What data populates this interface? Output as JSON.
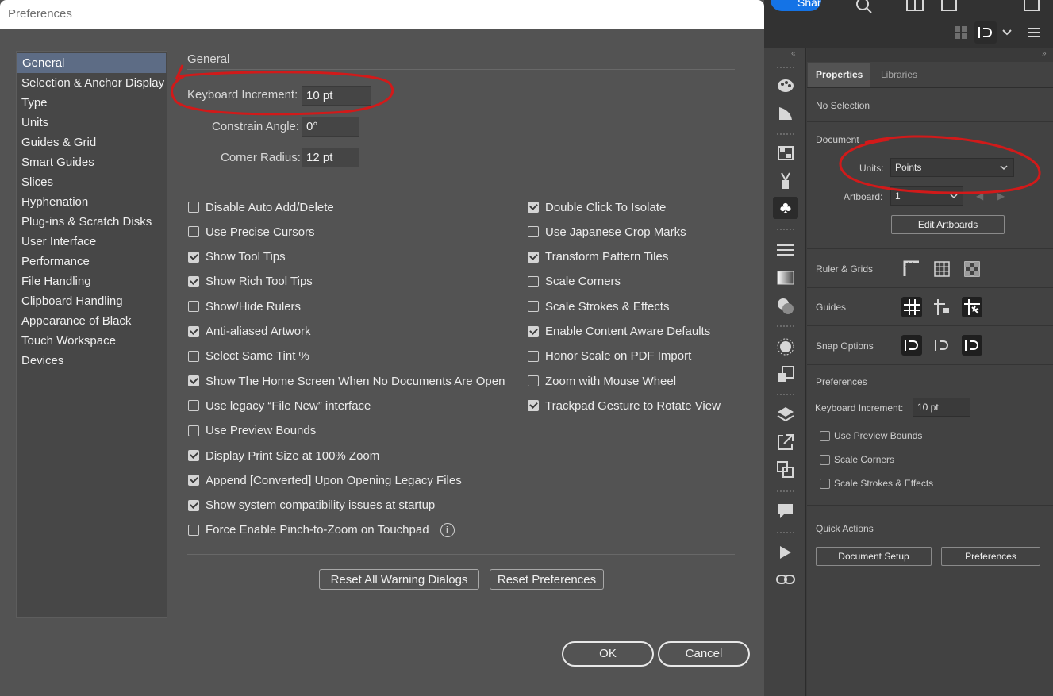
{
  "dialog": {
    "title": "Preferences",
    "sidebar": [
      {
        "label": "General",
        "selected": true
      },
      {
        "label": "Selection & Anchor Display"
      },
      {
        "label": "Type"
      },
      {
        "label": "Units"
      },
      {
        "label": "Guides & Grid"
      },
      {
        "label": "Smart Guides"
      },
      {
        "label": "Slices"
      },
      {
        "label": "Hyphenation"
      },
      {
        "label": "Plug-ins & Scratch Disks"
      },
      {
        "label": "User Interface"
      },
      {
        "label": "Performance"
      },
      {
        "label": "File Handling"
      },
      {
        "label": "Clipboard Handling"
      },
      {
        "label": "Appearance of Black"
      },
      {
        "label": "Touch Workspace"
      },
      {
        "label": "Devices"
      }
    ],
    "section_title": "General",
    "fields": {
      "keyboard_increment": {
        "label": "Keyboard Increment:",
        "value": "10 pt"
      },
      "constrain_angle": {
        "label": "Constrain Angle:",
        "value": "0°"
      },
      "corner_radius": {
        "label": "Corner Radius:",
        "value": "12 pt"
      }
    },
    "left_options": [
      {
        "label": "Disable Auto Add/Delete",
        "checked": false
      },
      {
        "label": "Use Precise Cursors",
        "checked": false
      },
      {
        "label": "Show Tool Tips",
        "checked": true
      },
      {
        "label": "Show Rich Tool Tips",
        "checked": true
      },
      {
        "label": "Show/Hide Rulers",
        "checked": false
      },
      {
        "label": "Anti-aliased Artwork",
        "checked": true
      },
      {
        "label": "Select Same Tint %",
        "checked": false
      },
      {
        "label": "Show The Home Screen When No Documents Are Open",
        "checked": true
      },
      {
        "label": "Use legacy “File New” interface",
        "checked": false
      },
      {
        "label": "Use Preview Bounds",
        "checked": false
      },
      {
        "label": "Display Print Size at 100% Zoom",
        "checked": true
      },
      {
        "label": "Append [Converted] Upon Opening Legacy Files",
        "checked": true
      },
      {
        "label": "Show system compatibility issues at startup",
        "checked": true
      },
      {
        "label": "Force Enable Pinch-to-Zoom on Touchpad",
        "checked": false
      }
    ],
    "right_options": [
      {
        "label": "Double Click To Isolate",
        "checked": true
      },
      {
        "label": "Use Japanese Crop Marks",
        "checked": false
      },
      {
        "label": "Transform Pattern Tiles",
        "checked": true
      },
      {
        "label": "Scale Corners",
        "checked": false
      },
      {
        "label": "Scale Strokes & Effects",
        "checked": false
      },
      {
        "label": "Enable Content Aware Defaults",
        "checked": true
      },
      {
        "label": "Honor Scale on PDF Import",
        "checked": false
      },
      {
        "label": "Zoom with Mouse Wheel",
        "checked": false
      },
      {
        "label": "Trackpad Gesture to Rotate View",
        "checked": true
      }
    ],
    "buttons": {
      "reset_warnings": "Reset All Warning Dialogs",
      "reset_prefs": "Reset Preferences",
      "ok": "OK",
      "cancel": "Cancel"
    }
  },
  "app": {
    "share_label": "Share",
    "tabs": {
      "properties": "Properties",
      "libraries": "Libraries"
    },
    "no_selection": "No Selection",
    "document_label": "Document",
    "units_label": "Units:",
    "units_value": "Points",
    "artboard_label": "Artboard:",
    "artboard_value": "1",
    "edit_artboards": "Edit Artboards",
    "ruler_grids": "Ruler & Grids",
    "guides": "Guides",
    "snap_options": "Snap Options",
    "preferences_title": "Preferences",
    "keyboard_increment_label": "Keyboard Increment:",
    "keyboard_increment_value": "10 pt",
    "checks": [
      "Use Preview Bounds",
      "Scale Corners",
      "Scale Strokes & Effects"
    ],
    "quick_actions": "Quick Actions",
    "document_setup": "Document Setup",
    "preferences_btn": "Preferences"
  },
  "colors": {
    "dialog_bg": "#535353",
    "selected_item": "#5d6c85",
    "annotation_red": "#d11a1a",
    "share_blue": "#1473e6"
  }
}
